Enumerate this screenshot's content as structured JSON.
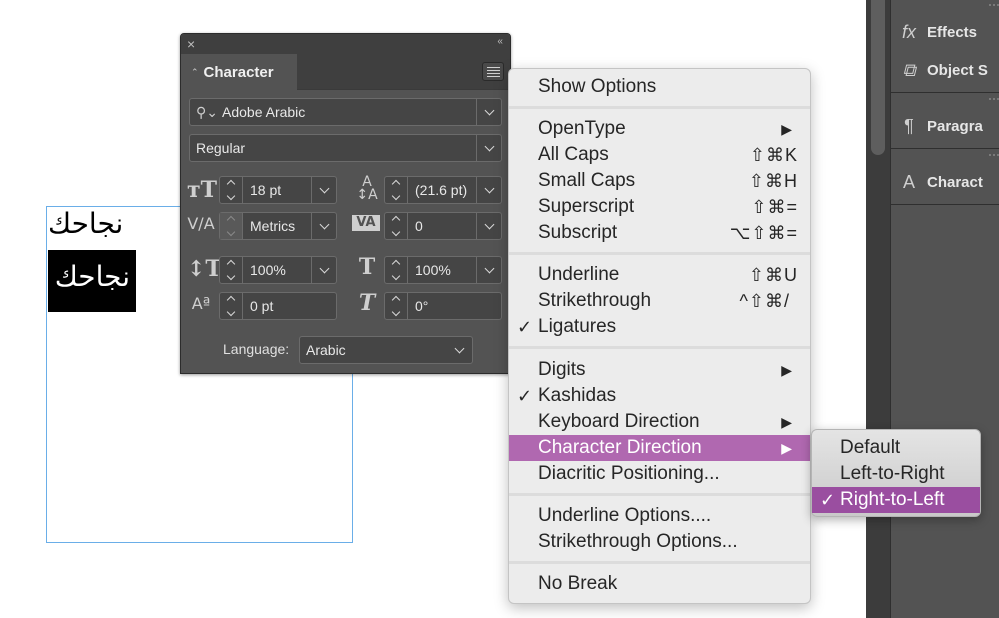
{
  "canvas": {
    "text_line_1": "نجاحك",
    "text_line_2_selected": "نجاحك"
  },
  "dock": {
    "items": [
      {
        "icon": "fx-icon",
        "label": "Effects"
      },
      {
        "icon": "object-styles-icon",
        "label": "Object S"
      },
      {
        "icon": "paragraph-styles-icon",
        "label": "Paragra"
      },
      {
        "icon": "character-styles-icon",
        "label": "Charact"
      }
    ]
  },
  "panel": {
    "close_glyph": "×",
    "collapse_glyph": "‹‹",
    "tab_label": "Character",
    "font_family": "Adobe Arabic",
    "font_style": "Regular",
    "font_size": "18 pt",
    "leading": "(21.6 pt)",
    "kerning": "Metrics",
    "tracking": "0",
    "vertical_scale": "100%",
    "horizontal_scale": "100%",
    "baseline_shift": "0 pt",
    "skew": "0°",
    "language_label": "Language:",
    "language": "Arabic"
  },
  "menu": {
    "items": [
      {
        "label": "Show Options"
      },
      {
        "label": "OpenType",
        "submenu": true
      },
      {
        "label": "All Caps",
        "shortcut": "⇧⌘K"
      },
      {
        "label": "Small Caps",
        "shortcut": "⇧⌘H"
      },
      {
        "label": "Superscript",
        "shortcut": "⇧⌘="
      },
      {
        "label": "Subscript",
        "shortcut": "⌥⇧⌘="
      },
      {
        "label": "Underline",
        "shortcut": "⇧⌘U"
      },
      {
        "label": "Strikethrough",
        "shortcut": "^⇧⌘/"
      },
      {
        "label": "Ligatures",
        "checked": true
      },
      {
        "label": "Digits",
        "submenu": true
      },
      {
        "label": "Kashidas",
        "checked": true
      },
      {
        "label": "Keyboard Direction",
        "submenu": true
      },
      {
        "label": "Character Direction",
        "submenu": true,
        "highlighted": true
      },
      {
        "label": "Diacritic Positioning..."
      },
      {
        "label": "Underline Options...."
      },
      {
        "label": "Strikethrough Options..."
      },
      {
        "label": "No Break"
      }
    ],
    "check_glyph": "✓",
    "arrow_glyph": "▶"
  },
  "submenu": {
    "items": [
      {
        "label": "Default"
      },
      {
        "label": "Left-to-Right"
      },
      {
        "label": "Right-to-Left",
        "checked": true,
        "highlighted": true
      }
    ]
  },
  "colors": {
    "highlight": "#b068b0",
    "panel_bg": "#535353",
    "frame_border": "#6aaee8"
  }
}
